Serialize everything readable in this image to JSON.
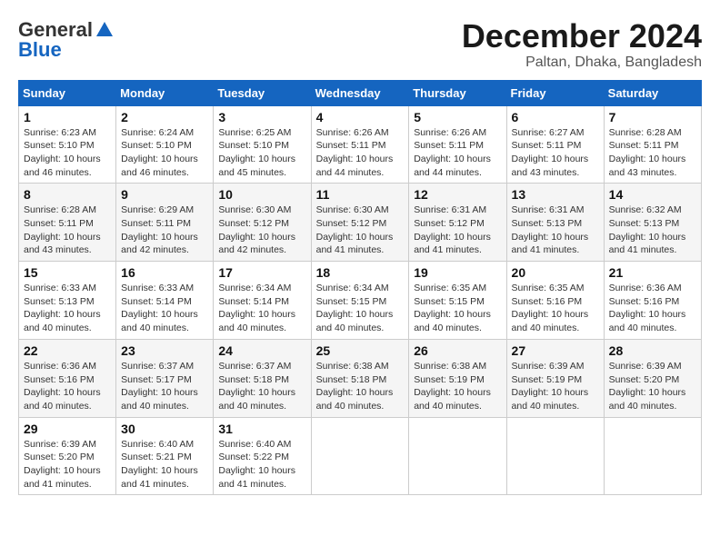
{
  "header": {
    "logo_general": "General",
    "logo_blue": "Blue",
    "month_title": "December 2024",
    "location": "Paltan, Dhaka, Bangladesh"
  },
  "weekdays": [
    "Sunday",
    "Monday",
    "Tuesday",
    "Wednesday",
    "Thursday",
    "Friday",
    "Saturday"
  ],
  "weeks": [
    [
      {
        "day": "1",
        "sunrise": "6:23 AM",
        "sunset": "5:10 PM",
        "daylight": "10 hours and 46 minutes."
      },
      {
        "day": "2",
        "sunrise": "6:24 AM",
        "sunset": "5:10 PM",
        "daylight": "10 hours and 46 minutes."
      },
      {
        "day": "3",
        "sunrise": "6:25 AM",
        "sunset": "5:10 PM",
        "daylight": "10 hours and 45 minutes."
      },
      {
        "day": "4",
        "sunrise": "6:26 AM",
        "sunset": "5:11 PM",
        "daylight": "10 hours and 44 minutes."
      },
      {
        "day": "5",
        "sunrise": "6:26 AM",
        "sunset": "5:11 PM",
        "daylight": "10 hours and 44 minutes."
      },
      {
        "day": "6",
        "sunrise": "6:27 AM",
        "sunset": "5:11 PM",
        "daylight": "10 hours and 43 minutes."
      },
      {
        "day": "7",
        "sunrise": "6:28 AM",
        "sunset": "5:11 PM",
        "daylight": "10 hours and 43 minutes."
      }
    ],
    [
      {
        "day": "8",
        "sunrise": "6:28 AM",
        "sunset": "5:11 PM",
        "daylight": "10 hours and 43 minutes."
      },
      {
        "day": "9",
        "sunrise": "6:29 AM",
        "sunset": "5:11 PM",
        "daylight": "10 hours and 42 minutes."
      },
      {
        "day": "10",
        "sunrise": "6:30 AM",
        "sunset": "5:12 PM",
        "daylight": "10 hours and 42 minutes."
      },
      {
        "day": "11",
        "sunrise": "6:30 AM",
        "sunset": "5:12 PM",
        "daylight": "10 hours and 41 minutes."
      },
      {
        "day": "12",
        "sunrise": "6:31 AM",
        "sunset": "5:12 PM",
        "daylight": "10 hours and 41 minutes."
      },
      {
        "day": "13",
        "sunrise": "6:31 AM",
        "sunset": "5:13 PM",
        "daylight": "10 hours and 41 minutes."
      },
      {
        "day": "14",
        "sunrise": "6:32 AM",
        "sunset": "5:13 PM",
        "daylight": "10 hours and 41 minutes."
      }
    ],
    [
      {
        "day": "15",
        "sunrise": "6:33 AM",
        "sunset": "5:13 PM",
        "daylight": "10 hours and 40 minutes."
      },
      {
        "day": "16",
        "sunrise": "6:33 AM",
        "sunset": "5:14 PM",
        "daylight": "10 hours and 40 minutes."
      },
      {
        "day": "17",
        "sunrise": "6:34 AM",
        "sunset": "5:14 PM",
        "daylight": "10 hours and 40 minutes."
      },
      {
        "day": "18",
        "sunrise": "6:34 AM",
        "sunset": "5:15 PM",
        "daylight": "10 hours and 40 minutes."
      },
      {
        "day": "19",
        "sunrise": "6:35 AM",
        "sunset": "5:15 PM",
        "daylight": "10 hours and 40 minutes."
      },
      {
        "day": "20",
        "sunrise": "6:35 AM",
        "sunset": "5:16 PM",
        "daylight": "10 hours and 40 minutes."
      },
      {
        "day": "21",
        "sunrise": "6:36 AM",
        "sunset": "5:16 PM",
        "daylight": "10 hours and 40 minutes."
      }
    ],
    [
      {
        "day": "22",
        "sunrise": "6:36 AM",
        "sunset": "5:16 PM",
        "daylight": "10 hours and 40 minutes."
      },
      {
        "day": "23",
        "sunrise": "6:37 AM",
        "sunset": "5:17 PM",
        "daylight": "10 hours and 40 minutes."
      },
      {
        "day": "24",
        "sunrise": "6:37 AM",
        "sunset": "5:18 PM",
        "daylight": "10 hours and 40 minutes."
      },
      {
        "day": "25",
        "sunrise": "6:38 AM",
        "sunset": "5:18 PM",
        "daylight": "10 hours and 40 minutes."
      },
      {
        "day": "26",
        "sunrise": "6:38 AM",
        "sunset": "5:19 PM",
        "daylight": "10 hours and 40 minutes."
      },
      {
        "day": "27",
        "sunrise": "6:39 AM",
        "sunset": "5:19 PM",
        "daylight": "10 hours and 40 minutes."
      },
      {
        "day": "28",
        "sunrise": "6:39 AM",
        "sunset": "5:20 PM",
        "daylight": "10 hours and 40 minutes."
      }
    ],
    [
      {
        "day": "29",
        "sunrise": "6:39 AM",
        "sunset": "5:20 PM",
        "daylight": "10 hours and 41 minutes."
      },
      {
        "day": "30",
        "sunrise": "6:40 AM",
        "sunset": "5:21 PM",
        "daylight": "10 hours and 41 minutes."
      },
      {
        "day": "31",
        "sunrise": "6:40 AM",
        "sunset": "5:22 PM",
        "daylight": "10 hours and 41 minutes."
      },
      null,
      null,
      null,
      null
    ]
  ],
  "labels": {
    "sunrise": "Sunrise: ",
    "sunset": "Sunset: ",
    "daylight": "Daylight: "
  }
}
